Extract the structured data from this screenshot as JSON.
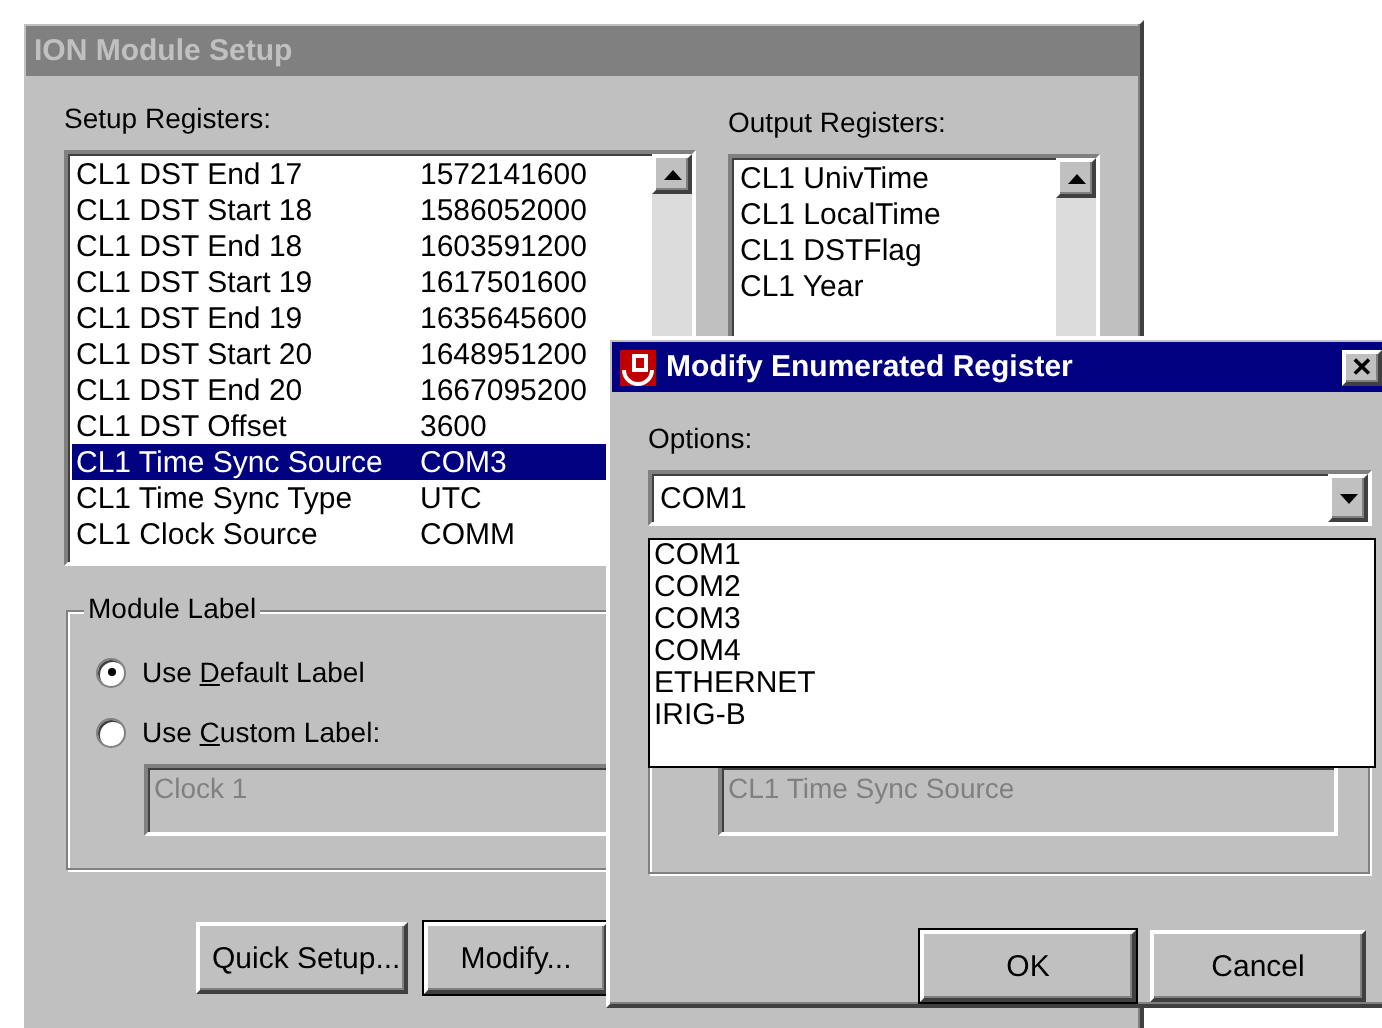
{
  "main_window": {
    "title": "ION Module Setup",
    "active": false,
    "setup_registers": {
      "label": "Setup Registers:",
      "rows": [
        {
          "name": "CL1 DST End 17",
          "value": "1572141600",
          "selected": false
        },
        {
          "name": "CL1 DST Start 18",
          "value": "1586052000",
          "selected": false
        },
        {
          "name": "CL1 DST End 18",
          "value": "1603591200",
          "selected": false
        },
        {
          "name": "CL1 DST Start 19",
          "value": "1617501600",
          "selected": false
        },
        {
          "name": "CL1 DST End 19",
          "value": "1635645600",
          "selected": false
        },
        {
          "name": "CL1 DST Start 20",
          "value": "1648951200",
          "selected": false
        },
        {
          "name": "CL1 DST End 20",
          "value": "1667095200",
          "selected": false
        },
        {
          "name": "CL1 DST Offset",
          "value": "3600",
          "selected": false
        },
        {
          "name": "CL1 Time Sync Source",
          "value": "COM3",
          "selected": true
        },
        {
          "name": "CL1 Time Sync Type",
          "value": "UTC",
          "selected": false
        },
        {
          "name": "CL1 Clock Source",
          "value": "COMM",
          "selected": false
        }
      ]
    },
    "output_registers": {
      "label": "Output Registers:",
      "rows": [
        "CL1 UnivTime",
        "CL1 LocalTime",
        "CL1 DSTFlag",
        "CL1 Year"
      ]
    },
    "module_label": {
      "title": "Module Label",
      "options": [
        {
          "label": "Use **D**efault Label",
          "selected": true
        },
        {
          "label": "Use **C**ustom Label:",
          "selected": false
        }
      ],
      "custom_label": {
        "value": "Clock 1",
        "disabled": true
      }
    },
    "buttons": [
      "Quick Setup...",
      "Modify..."
    ]
  },
  "dialog": {
    "title": "Modify Enumerated Register",
    "active": true,
    "close": "✕",
    "options_label": "Options:",
    "combo_value": "COM1",
    "dropdown": [
      "COM1",
      "COM2",
      "COM3",
      "COM4",
      "ETHERNET",
      "IRIG-B"
    ],
    "register_field": {
      "value": "CL1 Time Sync Source",
      "disabled": true
    },
    "buttons": [
      {
        "label": "OK",
        "default": true
      },
      {
        "label": "Cancel",
        "default": false
      }
    ]
  }
}
